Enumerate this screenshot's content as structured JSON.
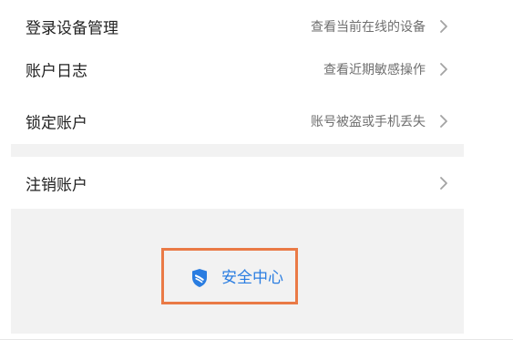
{
  "settings": {
    "items": [
      {
        "label": "登录设备管理",
        "hint": "查看当前在线的设备",
        "icon": "chevron-right-icon"
      },
      {
        "label": "账户日志",
        "hint": "查看近期敏感操作",
        "icon": "chevron-right-icon"
      },
      {
        "label": "锁定账户",
        "hint": "账号被盗或手机丢失",
        "icon": "chevron-right-icon"
      },
      {
        "label": "注销账户",
        "hint": "",
        "icon": "chevron-right-icon"
      }
    ]
  },
  "footer": {
    "label": "安全中心",
    "icon": "shield-icon",
    "color": "#2a7de1",
    "highlight_color": "#ea7a46"
  },
  "theme": {
    "page_bg": "#f2f2f2",
    "card_bg": "#ffffff",
    "text": "#222222",
    "hint": "#6f6f6f"
  }
}
